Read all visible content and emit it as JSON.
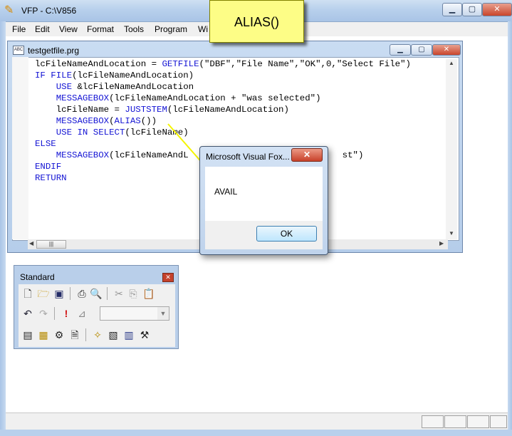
{
  "app": {
    "title": "VFP - C:\\V856"
  },
  "menu": [
    "File",
    "Edit",
    "View",
    "Format",
    "Tools",
    "Program",
    "Wi"
  ],
  "editor": {
    "title": "testgetfile.prg",
    "icon": "prg-file-icon",
    "code": [
      "lcFileNameAndLocation = GETFILE(\"DBF\",\"File Name\",\"OK\",0,\"Select File\")",
      "IF FILE(lcFileNameAndLocation)",
      "    USE &lcFileNameAndLocation",
      "    MESSAGEBOX(lcFileNameAndLocation + \"was selected\")",
      "    lcFileName = JUSTSTEM(lcFileNameAndLocation)",
      "    MESSAGEBOX(ALIAS())",
      "    USE IN SELECT(lcFileName)",
      "ELSE",
      "    MESSAGEBOX(lcFileNameAndL",
      "ENDIF",
      "RETURN"
    ],
    "code_tail": "st\")"
  },
  "callout": {
    "text": "ALIAS()",
    "color": "#fdfd86"
  },
  "dialog": {
    "title": "Microsoft Visual Fox...",
    "message": "AVAIL",
    "ok_label": "OK",
    "close": "✕"
  },
  "toolbar": {
    "title": "Standard",
    "close": "✕"
  },
  "colors": {
    "keyword": "#1414d4",
    "titlebar": "#b8d0ec"
  }
}
